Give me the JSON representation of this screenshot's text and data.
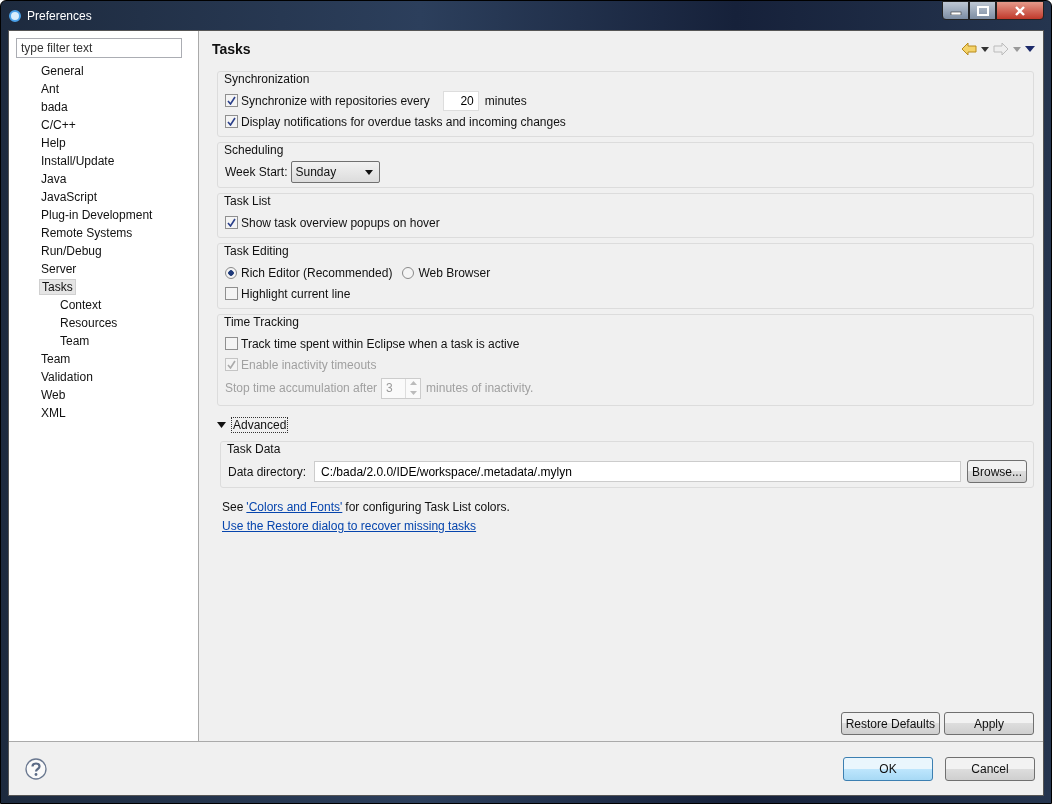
{
  "window": {
    "title": "Preferences"
  },
  "filter": {
    "placeholder": "type filter text"
  },
  "tree": [
    {
      "label": "General",
      "selected": false
    },
    {
      "label": "Ant",
      "selected": false
    },
    {
      "label": "bada",
      "selected": false
    },
    {
      "label": "C/C++",
      "selected": false
    },
    {
      "label": "Help",
      "selected": false
    },
    {
      "label": "Install/Update",
      "selected": false
    },
    {
      "label": "Java",
      "selected": false
    },
    {
      "label": "JavaScript",
      "selected": false
    },
    {
      "label": "Plug-in Development",
      "selected": false
    },
    {
      "label": "Remote Systems",
      "selected": false
    },
    {
      "label": "Run/Debug",
      "selected": false
    },
    {
      "label": "Server",
      "selected": false
    },
    {
      "label": "Tasks",
      "selected": true,
      "children": [
        {
          "label": "Context",
          "selected": false
        },
        {
          "label": "Resources",
          "selected": false
        },
        {
          "label": "Team",
          "selected": false
        }
      ]
    },
    {
      "label": "Team",
      "selected": false
    },
    {
      "label": "Validation",
      "selected": false
    },
    {
      "label": "Web",
      "selected": false
    },
    {
      "label": "XML",
      "selected": false
    }
  ],
  "page": {
    "title": "Tasks"
  },
  "sections": [
    {
      "title": "Synchronization",
      "rows": [
        {
          "kind": "checkbox_field",
          "label": "Synchronize with repositories every",
          "checked": true,
          "value": "20",
          "suffix": "minutes"
        },
        {
          "kind": "checkbox",
          "label": "Display notifications for overdue tasks and incoming changes",
          "checked": true,
          "disabled": false
        }
      ]
    },
    {
      "title": "Scheduling",
      "rows": [
        {
          "kind": "combo",
          "label": "Week Start:",
          "value": "Sunday"
        }
      ]
    },
    {
      "title": "Task List",
      "rows": [
        {
          "kind": "checkbox",
          "label": "Show task overview popups on hover",
          "checked": true,
          "disabled": false
        }
      ]
    },
    {
      "title": "Task Editing",
      "rows": [
        {
          "kind": "radios",
          "options": [
            {
              "label": "Rich Editor (Recommended)",
              "selected": true
            },
            {
              "label": "Web Browser",
              "selected": false
            }
          ]
        },
        {
          "kind": "checkbox",
          "label": "Highlight current line",
          "checked": false,
          "disabled": false
        }
      ]
    },
    {
      "title": "Time Tracking",
      "rows": [
        {
          "kind": "checkbox",
          "label": "Track time spent within Eclipse when a task is active",
          "checked": false,
          "disabled": false
        },
        {
          "kind": "checkbox",
          "label": "Enable inactivity timeouts",
          "checked": true,
          "disabled": true
        },
        {
          "kind": "spinner",
          "label": "Stop time accumulation after",
          "value": "3",
          "suffix": "minutes of inactivity.",
          "disabled": true
        }
      ]
    }
  ],
  "advanced": {
    "label": "Advanced",
    "expanded": true,
    "group": {
      "title": "Task Data",
      "label": "Data directory:",
      "value": "C:/bada/2.0.0/IDE/workspace/.metadata/.mylyn",
      "button": "Browse..."
    }
  },
  "note": {
    "before": "See",
    "link": "'Colors and Fonts'",
    "after": "for configuring Task List colors."
  },
  "restore_link": "Use the Restore dialog to recover missing tasks",
  "page_buttons": [
    "Restore Defaults",
    "Apply"
  ],
  "dialog_buttons": [
    {
      "label": "OK",
      "selected": true
    },
    {
      "label": "Cancel",
      "selected": false
    }
  ]
}
